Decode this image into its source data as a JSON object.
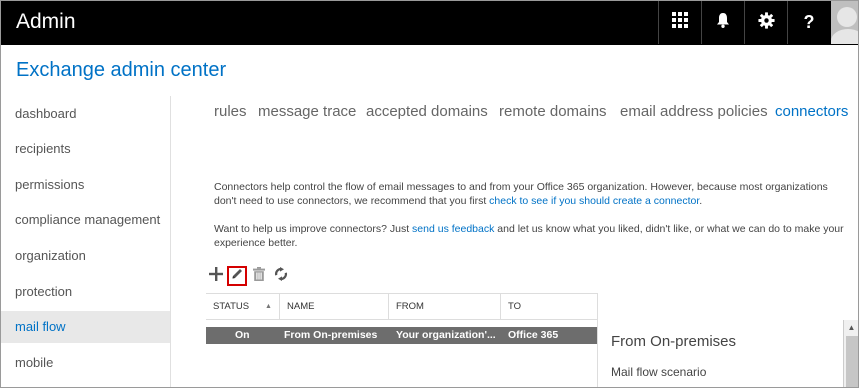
{
  "topbar": {
    "app_title": "Admin",
    "buttons": [
      {
        "icon": "app-launcher-icon",
        "label": ""
      },
      {
        "icon": "bell-icon",
        "label": ""
      },
      {
        "icon": "gear-icon",
        "label": ""
      },
      {
        "icon": "help-icon",
        "label": "?"
      }
    ]
  },
  "header": {
    "title": "Exchange admin center"
  },
  "sidebar": {
    "items": [
      {
        "label": "dashboard"
      },
      {
        "label": "recipients"
      },
      {
        "label": "permissions"
      },
      {
        "label": "compliance management"
      },
      {
        "label": "organization"
      },
      {
        "label": "protection"
      },
      {
        "label": "mail flow"
      },
      {
        "label": "mobile"
      }
    ],
    "active_index": 6
  },
  "tabs": [
    {
      "label": "rules"
    },
    {
      "label": "message trace"
    },
    {
      "label": "accepted domains"
    },
    {
      "label": "remote domains"
    },
    {
      "label": "email address policies"
    },
    {
      "label": "connectors"
    }
  ],
  "description": {
    "para1_text": "Connectors help control the flow of email messages to and from your Office 365 organization. However, because most organizations don't need to use connectors, we recommend that you first ",
    "para1_link": "check to see if you should create a connector",
    "para1_end": ".",
    "para2_start": "Want to help us improve connectors? Just ",
    "para2_link": "send us feedback",
    "para2_end": " and let us know what you liked, didn't like, or what we can do to make your experience better."
  },
  "toolbar": {
    "add_icon": "plus-icon",
    "edit_icon": "pencil-icon",
    "delete_icon": "trash-icon",
    "refresh_icon": "refresh-icon"
  },
  "table": {
    "columns": [
      "STATUS",
      "NAME",
      "FROM",
      "TO"
    ],
    "sort_indicator": "▲",
    "rows": [
      {
        "status": "On",
        "name": "From On-premises",
        "from": "Your organization'...",
        "to": "Office 365"
      }
    ]
  },
  "details": {
    "title": "From On-premises",
    "label": "Mail flow scenario"
  },
  "colors": {
    "accent": "#0072c6",
    "topbar_bg": "#000000",
    "selected_row": "#6d6d6d",
    "highlight_box": "#d40000"
  }
}
